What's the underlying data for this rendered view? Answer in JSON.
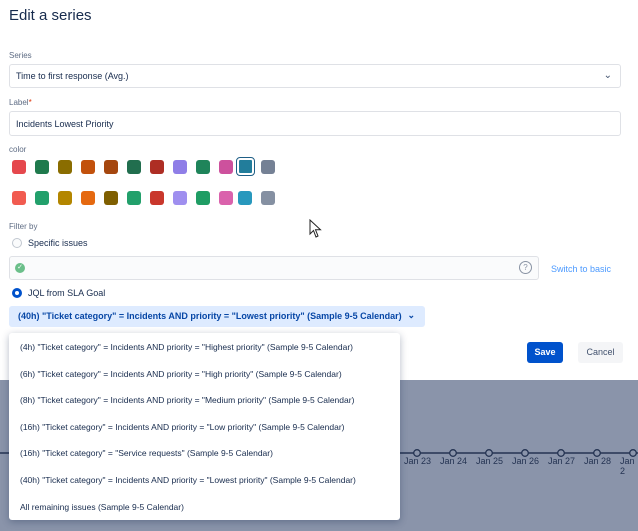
{
  "dialog": {
    "title": "Edit a series",
    "series_label": "Series",
    "series_value": "Time to first response (Avg.)",
    "label_label": "Label",
    "label_required": "*",
    "label_value": "Incidents Lowest Priority",
    "color_label": "color",
    "colors_row1": [
      "#e5484d",
      "#1f7a4d",
      "#8a6d00",
      "#c2510c",
      "#a5470f",
      "#216e4e",
      "#ae2e24",
      "#8f7ee7",
      "#1f845a",
      "#cd519d",
      "#227d9b",
      "#758195"
    ],
    "colors_row2": [
      "#f15b50",
      "#22a06b",
      "#b38600",
      "#e56910",
      "#7f5f01",
      "#22a06b",
      "#c9372c",
      "#9f8fef",
      "#1f9d64",
      "#da62ac",
      "#2898bd",
      "#8590a2"
    ],
    "selected_color_index": 10,
    "filter_label": "Filter by",
    "option_specific": "Specific issues",
    "option_jql": "JQL from SLA Goal",
    "switch_link": "Switch to basic",
    "selected_goal": "(40h) \"Ticket category\" = Incidents AND priority = \"Lowest priority\" (Sample 9-5 Calendar)",
    "save": "Save",
    "cancel": "Cancel"
  },
  "goal_menu": {
    "items": [
      "(4h) \"Ticket category\" = Incidents AND priority = \"Highest priority\" (Sample 9-5 Calendar)",
      "(6h) \"Ticket category\" = Incidents AND priority = \"High priority\" (Sample 9-5 Calendar)",
      "(8h) \"Ticket category\" = Incidents AND priority = \"Medium priority\" (Sample 9-5 Calendar)",
      "(16h) \"Ticket category\" = Incidents AND priority = \"Low priority\" (Sample 9-5 Calendar)",
      "(16h) \"Ticket category\" = \"Service requests\" (Sample 9-5 Calendar)",
      "(40h) \"Ticket category\" = Incidents AND priority = \"Lowest priority\" (Sample 9-5 Calendar)",
      "All remaining issues (Sample 9-5 Calendar)"
    ]
  },
  "background_chart": {
    "x_ticks": [
      "Jan 23",
      "Jan 24",
      "Jan 25",
      "Jan 26",
      "Jan 27",
      "Jan 28",
      "Jan 2"
    ]
  },
  "icons": {
    "chevron": "chevron-down-icon",
    "valid": "check-circle-icon",
    "help": "help-icon"
  }
}
